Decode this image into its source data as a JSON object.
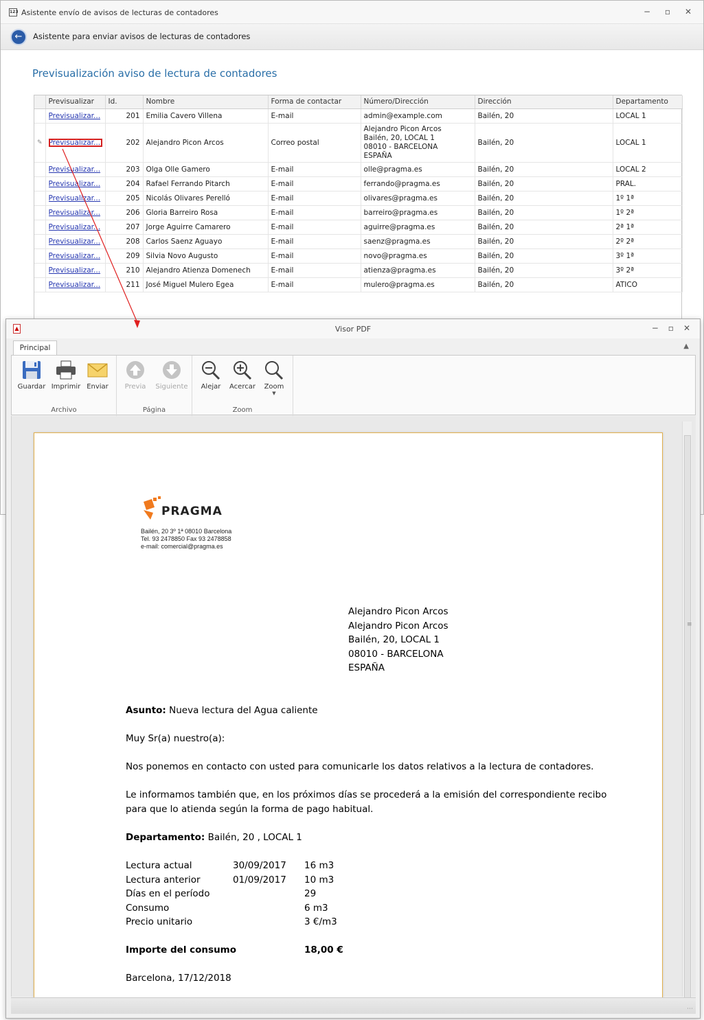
{
  "main_window": {
    "title": "Asistente envío de avisos de lecturas de contadores",
    "header_title": "Asistente para enviar avisos de lecturas de contadores",
    "section_title": "Previsualización aviso de lectura de contadores",
    "controls": {
      "minimize": "−",
      "restore": "▫",
      "close": "✕"
    }
  },
  "grid": {
    "columns": [
      "Previsualizar",
      "Id.",
      "Nombre",
      "Forma de contactar",
      "Número/Dirección",
      "Dirección",
      "Departamento"
    ],
    "rows": [
      {
        "link": "Previsualizar...",
        "id": "201",
        "nombre": "Emilia Cavero Villena",
        "forma": "E-mail",
        "numero": "admin@example.com",
        "direccion": "Bailén, 20",
        "depto": "LOCAL 1"
      },
      {
        "link": "Previsualizar...",
        "id": "202",
        "nombre": "Alejandro Picon Arcos",
        "forma": "Correo postal",
        "numero_lines": [
          "Alejandro Picon Arcos",
          "Bailén, 20, LOCAL 1",
          "08010 - BARCELONA",
          "ESPAÑA"
        ],
        "direccion": "Bailén, 20",
        "depto": "LOCAL 1"
      },
      {
        "link": "Previsualizar...",
        "id": "203",
        "nombre": "Olga Olle Gamero",
        "forma": "E-mail",
        "numero": "olle@pragma.es",
        "direccion": "Bailén, 20",
        "depto": "LOCAL 2"
      },
      {
        "link": "Previsualizar...",
        "id": "204",
        "nombre": "Rafael Ferrando Pitarch",
        "forma": "E-mail",
        "numero": "ferrando@pragma.es",
        "direccion": "Bailén, 20",
        "depto": "PRAL."
      },
      {
        "link": "Previsualizar...",
        "id": "205",
        "nombre": "Nicolás Olivares Perelló",
        "forma": "E-mail",
        "numero": "olivares@pragma.es",
        "direccion": "Bailén, 20",
        "depto": "1º 1ª"
      },
      {
        "link": "Previsualizar...",
        "id": "206",
        "nombre": "Gloria Barreiro Rosa",
        "forma": "E-mail",
        "numero": "barreiro@pragma.es",
        "direccion": "Bailén, 20",
        "depto": "1º 2ª"
      },
      {
        "link": "Previsualizar...",
        "id": "207",
        "nombre": "Jorge Aguirre Camarero",
        "forma": "E-mail",
        "numero": "aguirre@pragma.es",
        "direccion": "Bailén, 20",
        "depto": "2ª 1ª"
      },
      {
        "link": "Previsualizar...",
        "id": "208",
        "nombre": "Carlos Saenz Aguayo",
        "forma": "E-mail",
        "numero": "saenz@pragma.es",
        "direccion": "Bailén, 20",
        "depto": "2º 2ª"
      },
      {
        "link": "Previsualizar...",
        "id": "209",
        "nombre": "Silvia Novo Augusto",
        "forma": "E-mail",
        "numero": "novo@pragma.es",
        "direccion": "Bailén, 20",
        "depto": "3º 1ª"
      },
      {
        "link": "Previsualizar...",
        "id": "210",
        "nombre": "Alejandro Atienza Domenech",
        "forma": "E-mail",
        "numero": "atienza@pragma.es",
        "direccion": "Bailén, 20",
        "depto": "3º 2ª"
      },
      {
        "link": "Previsualizar...",
        "id": "211",
        "nombre": "José Miguel Mulero Egea",
        "forma": "E-mail",
        "numero": "mulero@pragma.es",
        "direccion": "Bailén, 20",
        "depto": "ATICO"
      }
    ]
  },
  "pdf_viewer": {
    "title": "Visor PDF",
    "tab": "Principal",
    "groups": {
      "archivo": {
        "label": "Archivo",
        "buttons": [
          "Guardar",
          "Imprimir",
          "Enviar"
        ]
      },
      "pagina": {
        "label": "Página",
        "buttons": [
          "Previa",
          "Siguiente"
        ]
      },
      "zoom": {
        "label": "Zoom",
        "buttons": [
          "Alejar",
          "Acercar",
          "Zoom"
        ]
      }
    }
  },
  "document": {
    "logo_text": "PRAGMA",
    "company_lines": [
      "Bailén, 20 3º 1ª 08010 Barcelona",
      "Tel. 93 2478850 Fax 93 2478858",
      "e-mail: comercial@pragma.es"
    ],
    "recipient": [
      "Alejandro Picon Arcos",
      "Alejandro Picon Arcos",
      "Bailén, 20, LOCAL 1",
      "08010 - BARCELONA",
      "ESPAÑA"
    ],
    "asunto_label": "Asunto:",
    "asunto_value": " Nueva lectura del Agua caliente",
    "greeting": "Muy Sr(a) nuestro(a):",
    "paragraph1": "Nos ponemos en contacto con usted para comunicarle los datos relativos a la lectura de contadores.",
    "paragraph2_line1": "Le informamos también que, en los próximos días se procederá a la emisión del correspondiente recibo",
    "paragraph2_line2": "para que lo atienda según la forma de pago habitual.",
    "departamento_label": "Departamento:",
    "departamento_value": " Bailén, 20 , LOCAL 1",
    "readings": [
      {
        "label": "Lectura actual",
        "date": "30/09/2017",
        "value": "16 m3"
      },
      {
        "label": "Lectura anterior",
        "date": "01/09/2017",
        "value": "10 m3"
      },
      {
        "label": "Días en el período",
        "date": "",
        "value": "29"
      },
      {
        "label": "Consumo",
        "date": "",
        "value": "6 m3"
      },
      {
        "label": "Precio unitario",
        "date": "",
        "value": "3 €/m3"
      }
    ],
    "importe_label": "Importe del consumo",
    "importe_value": "18,00 €",
    "closing": "Barcelona, 17/12/2018"
  },
  "colors": {
    "accent": "#2a6fa8",
    "link": "#2536b0",
    "highlight": "#d42020",
    "logo_orange": "#f07a1e"
  }
}
